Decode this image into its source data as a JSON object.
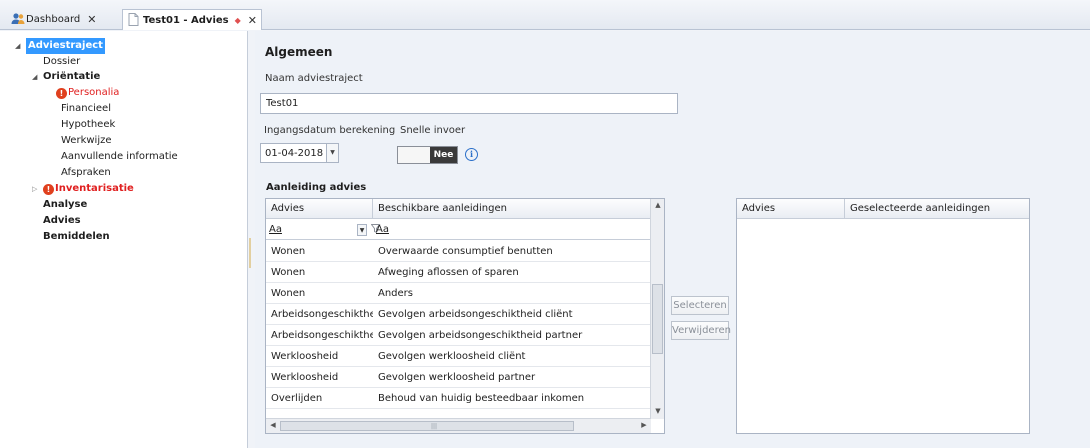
{
  "tabs": [
    {
      "label": "Dashboard",
      "close": "✕",
      "active": false
    },
    {
      "label": "Test01 - Advies",
      "close": "✕",
      "active": true,
      "dirty": "◆"
    }
  ],
  "tree": {
    "items": [
      {
        "label": "Adviestraject",
        "selected": true,
        "expander": "◢"
      },
      {
        "label": "Dossier"
      },
      {
        "label": "Oriëntatie",
        "expander": "◢"
      },
      {
        "label": "Personalia",
        "warning": true
      },
      {
        "label": "Financieel"
      },
      {
        "label": "Hypotheek"
      },
      {
        "label": "Werkwijze"
      },
      {
        "label": "Aanvullende informatie"
      },
      {
        "label": "Afspraken"
      },
      {
        "label": "Inventarisatie",
        "warning": true,
        "expander": "▷"
      },
      {
        "label": "Analyse"
      },
      {
        "label": "Advies"
      },
      {
        "label": "Bemiddelen"
      }
    ]
  },
  "main": {
    "section_title": "Algemeen",
    "name_label": "Naam adviestraject",
    "name_value": "Test01",
    "date_label": "Ingangsdatum berekening",
    "date_value": "01-04-2018",
    "quick_label": "Snelle invoer",
    "toggle_value": "Nee",
    "info_glyph": "i",
    "reasons_title": "Aanleiding advies"
  },
  "grid": {
    "headers": [
      "Advies",
      "Beschikbare aanleidingen"
    ],
    "filter": [
      "Aa",
      "Aa"
    ],
    "rows": [
      [
        "Wonen",
        "Overwaarde consumptief benutten"
      ],
      [
        "Wonen",
        "Afweging aflossen of sparen"
      ],
      [
        "Wonen",
        "Anders"
      ],
      [
        "Arbeidsongeschikthei",
        "Gevolgen arbeidsongeschiktheid cliënt"
      ],
      [
        "Arbeidsongeschikthei",
        "Gevolgen arbeidsongeschiktheid partner"
      ],
      [
        "Werkloosheid",
        "Gevolgen werkloosheid cliënt"
      ],
      [
        "Werkloosheid",
        "Gevolgen werkloosheid partner"
      ],
      [
        "Overlijden",
        "Behoud van huidig besteedbaar inkomen"
      ]
    ],
    "scroll_grip": "|||"
  },
  "buttons": {
    "select": "Selecteren",
    "remove": "Verwijderen"
  },
  "grid2": {
    "headers": [
      "Advies",
      "Geselecteerde aanleidingen"
    ]
  }
}
